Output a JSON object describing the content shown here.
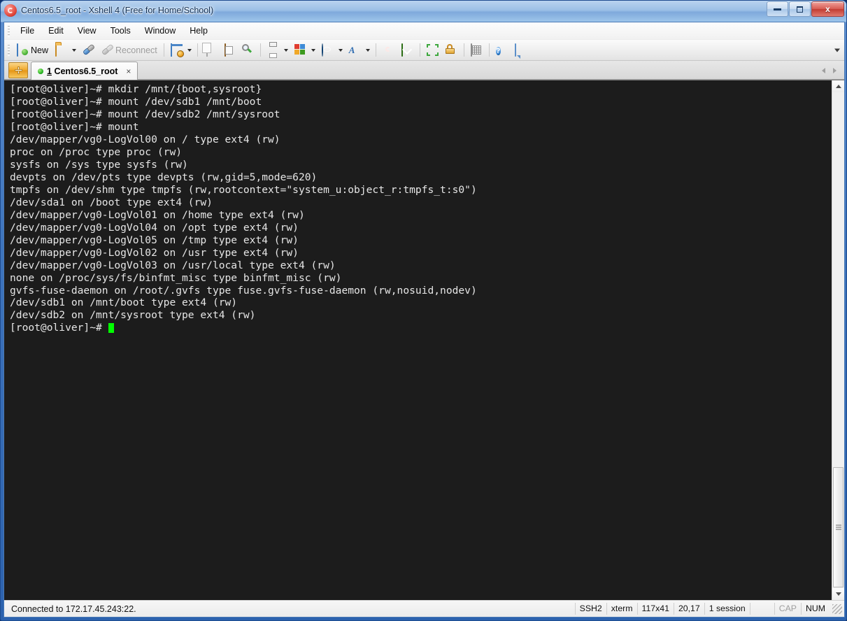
{
  "window": {
    "title": "Centos6.5_root - Xshell 4 (Free for Home/School)",
    "app_icon": "xshell-logo-icon",
    "controls": {
      "minimize": "minimize-button",
      "restore": "restore-button",
      "close_glyph": "x"
    }
  },
  "menu": {
    "items": [
      {
        "label": "File"
      },
      {
        "label": "Edit"
      },
      {
        "label": "View"
      },
      {
        "label": "Tools"
      },
      {
        "label": "Window"
      },
      {
        "label": "Help"
      }
    ]
  },
  "toolbar": {
    "new_label": "New",
    "reconnect_label": "Reconnect",
    "icons": {
      "new": "new-session-icon",
      "open": "open-folder-icon",
      "connect": "connect-plug-icon",
      "reconnect": "reconnect-plug-icon",
      "properties": "session-properties-icon",
      "copy": "copy-icon",
      "paste": "paste-icon",
      "find": "find-icon",
      "print": "print-icon",
      "layout": "layout-icon",
      "globe": "globe-icon",
      "font": "font-icon",
      "xshell": "xshell-icon",
      "xftp": "xftp-icon",
      "fullscreen": "fullscreen-icon",
      "lock": "lock-icon",
      "keyboard": "keyboard-icon",
      "help": "help-icon",
      "chat": "chat-icon",
      "overflow": "toolbar-overflow-icon"
    }
  },
  "tabs": {
    "new_tab_icon": "new-tab-plus-icon",
    "items": [
      {
        "index": "1",
        "name": "Centos6.5_root",
        "close_glyph": "×",
        "active": true
      }
    ],
    "nav_prev_icon": "tab-scroll-left-icon",
    "nav_next_icon": "tab-scroll-right-icon"
  },
  "terminal": {
    "colors": {
      "background": "#1c1c1c",
      "foreground": "#e6e6e6",
      "cursor": "#00ff00"
    },
    "lines": [
      "[root@oliver]~# mkdir /mnt/{boot,sysroot}",
      "[root@oliver]~# mount /dev/sdb1 /mnt/boot",
      "[root@oliver]~# mount /dev/sdb2 /mnt/sysroot",
      "[root@oliver]~# mount",
      "/dev/mapper/vg0-LogVol00 on / type ext4 (rw)",
      "proc on /proc type proc (rw)",
      "sysfs on /sys type sysfs (rw)",
      "devpts on /dev/pts type devpts (rw,gid=5,mode=620)",
      "tmpfs on /dev/shm type tmpfs (rw,rootcontext=\"system_u:object_r:tmpfs_t:s0\")",
      "/dev/sda1 on /boot type ext4 (rw)",
      "/dev/mapper/vg0-LogVol01 on /home type ext4 (rw)",
      "/dev/mapper/vg0-LogVol04 on /opt type ext4 (rw)",
      "/dev/mapper/vg0-LogVol05 on /tmp type ext4 (rw)",
      "/dev/mapper/vg0-LogVol02 on /usr type ext4 (rw)",
      "/dev/mapper/vg0-LogVol03 on /usr/local type ext4 (rw)",
      "none on /proc/sys/fs/binfmt_misc type binfmt_misc (rw)",
      "gvfs-fuse-daemon on /root/.gvfs type fuse.gvfs-fuse-daemon (rw,nosuid,nodev)",
      "/dev/sdb1 on /mnt/boot type ext4 (rw)",
      "/dev/sdb2 on /mnt/sysroot type ext4 (rw)"
    ],
    "prompt": "[root@oliver]~# "
  },
  "scrollbar": {
    "up_icon": "scroll-up-arrow-icon",
    "down_icon": "scroll-down-arrow-icon",
    "grip_icon": "scrollbar-grip-icon"
  },
  "statusbar": {
    "message": "Connected to 172.17.45.243:22.",
    "cells": [
      {
        "label": "SSH2",
        "dim": false
      },
      {
        "label": "xterm",
        "dim": false
      },
      {
        "label": "117x41",
        "dim": false
      },
      {
        "label": "20,17",
        "dim": false
      },
      {
        "label": "1 session",
        "dim": false
      },
      {
        "label": "",
        "dim": false
      },
      {
        "label": "CAP",
        "dim": true
      },
      {
        "label": "NUM",
        "dim": false
      }
    ],
    "resize_grip_icon": "resize-grip-icon"
  }
}
